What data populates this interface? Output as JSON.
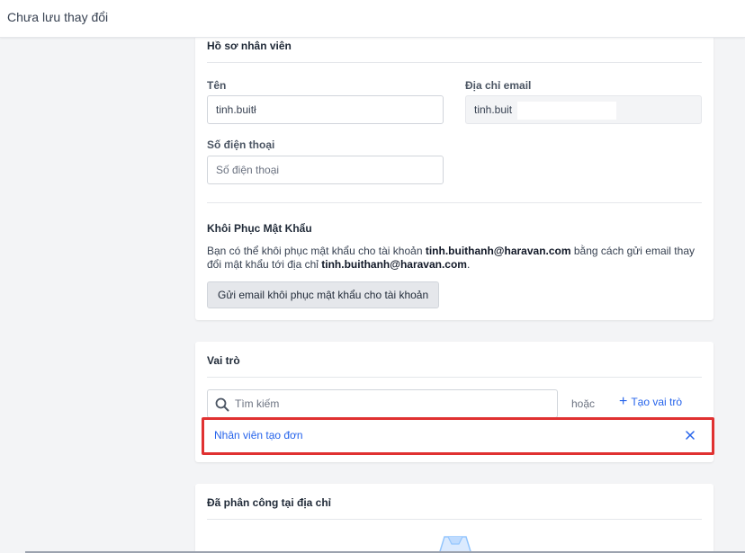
{
  "topbar": {
    "title": "Chưa lưu thay đổi"
  },
  "profile": {
    "title": "Hồ sơ nhân viên",
    "name_label": "Tên",
    "name_value": "tinh.buitł",
    "email_label": "Địa chỉ email",
    "email_value": "tinh.buit",
    "phone_label": "Số điện thoại",
    "phone_placeholder": "Số điện thoại"
  },
  "password": {
    "title": "Khôi Phục Mật Khẩu",
    "desc_prefix": "Bạn có thể khôi phục mật khẩu cho tài khoản ",
    "email_1": "tinh.buithanh@haravan.com",
    "desc_middle": " bằng cách gửi email thay đổi mật khẩu tới địa chỉ ",
    "email_2": "tinh.buithanh@haravan.com",
    "desc_suffix": ".",
    "button_label": "Gửi email khôi phục mật khẩu cho tài khoản"
  },
  "roles": {
    "title": "Vai trò",
    "search_placeholder": "Tìm kiếm",
    "or_label": "hoặc",
    "create_label": "Tạo vai trò",
    "items": [
      {
        "name": "Nhân viên tạo đơn"
      }
    ]
  },
  "assign": {
    "title": "Đã phân công tại địa chỉ"
  },
  "colors": {
    "accent": "#2563eb",
    "highlight": "#e03131",
    "background": "#f3f4f6"
  },
  "icons": {
    "search": "search-icon",
    "close": "close-icon",
    "plus": "plus-icon"
  }
}
